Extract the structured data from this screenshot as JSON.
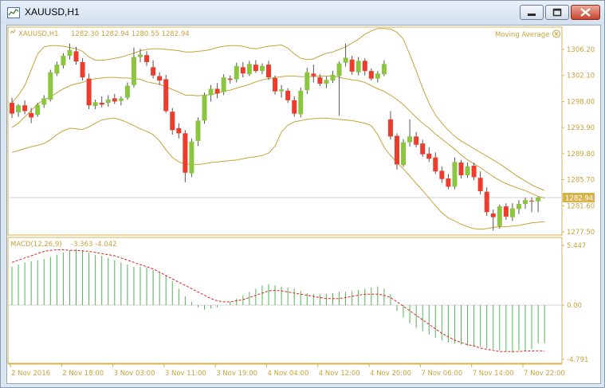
{
  "window": {
    "title": "XAUUSD,H1",
    "icon": "chart-window-icon",
    "controls": [
      "minimize-icon",
      "maximize-icon",
      "close-icon"
    ]
  },
  "main_chart": {
    "label": "XAUUSD,H1",
    "ohlc": "1282.30 1282.94 1280.55 1282.94",
    "indicator_label": "Moving Average",
    "indicator_icon": "moving-average-icon",
    "price_ticks": [
      "1306.20",
      "1302.10",
      "1298.00",
      "1293.90",
      "1289.80",
      "1285.70",
      "1281.60",
      "1277.50"
    ],
    "current_price": "1282.94"
  },
  "macd_panel": {
    "label": "MACD(12,26,9)",
    "values": "-3.363 -4.042",
    "ticks": [
      "5.447",
      "0.00",
      "-4.791"
    ]
  },
  "time_axis": [
    "2 Nov 2016",
    "2 Nov 18:00",
    "3 Nov 03:00",
    "3 Nov 11:00",
    "3 Nov 19:00",
    "4 Nov 04:00",
    "4 Nov 12:00",
    "4 Nov 20:00",
    "7 Nov 06:00",
    "7 Nov 14:00",
    "7 Nov 22:00"
  ],
  "colors": {
    "bull": "#8cc63f",
    "bear": "#ee3b2b",
    "bands": "#c8a33a",
    "frame": "#d8b24a",
    "macd_hist": "#52b553",
    "macd_signal": "#e02020",
    "text": "#c8a33a"
  },
  "chart_data": [
    {
      "type": "candlestick",
      "title": "XAUUSD,H1",
      "ylim": [
        1277.5,
        1306.2
      ],
      "candles": [
        {
          "o": 1297.8,
          "h": 1298.6,
          "l": 1295.4,
          "c": 1296.1
        },
        {
          "o": 1296.3,
          "h": 1297.6,
          "l": 1295.6,
          "c": 1297.4
        },
        {
          "o": 1297.4,
          "h": 1298.2,
          "l": 1296.0,
          "c": 1296.5
        },
        {
          "o": 1296.2,
          "h": 1297.0,
          "l": 1294.6,
          "c": 1295.5
        },
        {
          "o": 1295.9,
          "h": 1297.8,
          "l": 1295.6,
          "c": 1297.5
        },
        {
          "o": 1297.5,
          "h": 1299.0,
          "l": 1297.0,
          "c": 1298.5
        },
        {
          "o": 1298.3,
          "h": 1303.0,
          "l": 1298.0,
          "c": 1302.6
        },
        {
          "o": 1302.4,
          "h": 1304.3,
          "l": 1302.0,
          "c": 1303.8
        },
        {
          "o": 1303.7,
          "h": 1305.6,
          "l": 1303.2,
          "c": 1305.2
        },
        {
          "o": 1305.2,
          "h": 1307.1,
          "l": 1304.6,
          "c": 1306.1
        },
        {
          "o": 1305.9,
          "h": 1306.6,
          "l": 1303.8,
          "c": 1304.3
        },
        {
          "o": 1304.2,
          "h": 1304.8,
          "l": 1301.3,
          "c": 1301.8
        },
        {
          "o": 1301.6,
          "h": 1302.4,
          "l": 1296.8,
          "c": 1297.4
        },
        {
          "o": 1297.3,
          "h": 1298.3,
          "l": 1296.8,
          "c": 1297.9
        },
        {
          "o": 1297.8,
          "h": 1298.8,
          "l": 1297.1,
          "c": 1297.5
        },
        {
          "o": 1297.8,
          "h": 1299.0,
          "l": 1297.2,
          "c": 1298.3
        },
        {
          "o": 1298.5,
          "h": 1299.2,
          "l": 1297.6,
          "c": 1298.0
        },
        {
          "o": 1298.1,
          "h": 1298.8,
          "l": 1297.4,
          "c": 1298.5
        },
        {
          "o": 1298.6,
          "h": 1301.0,
          "l": 1298.3,
          "c": 1300.5
        },
        {
          "o": 1300.6,
          "h": 1306.5,
          "l": 1300.2,
          "c": 1305.0
        },
        {
          "o": 1305.0,
          "h": 1306.3,
          "l": 1304.2,
          "c": 1305.4
        },
        {
          "o": 1305.3,
          "h": 1305.9,
          "l": 1303.6,
          "c": 1304.2
        },
        {
          "o": 1303.4,
          "h": 1304.5,
          "l": 1301.6,
          "c": 1302.1
        },
        {
          "o": 1302.0,
          "h": 1302.6,
          "l": 1300.6,
          "c": 1301.3
        },
        {
          "o": 1301.5,
          "h": 1302.2,
          "l": 1296.2,
          "c": 1296.5
        },
        {
          "o": 1296.4,
          "h": 1297.0,
          "l": 1292.8,
          "c": 1293.5
        },
        {
          "o": 1293.8,
          "h": 1294.6,
          "l": 1292.2,
          "c": 1293.0
        },
        {
          "o": 1293.0,
          "h": 1293.5,
          "l": 1285.3,
          "c": 1286.8
        },
        {
          "o": 1286.7,
          "h": 1292.2,
          "l": 1286.1,
          "c": 1291.7
        },
        {
          "o": 1291.8,
          "h": 1295.5,
          "l": 1291.0,
          "c": 1295.0
        },
        {
          "o": 1295.0,
          "h": 1299.4,
          "l": 1294.5,
          "c": 1299.0
        },
        {
          "o": 1299.0,
          "h": 1300.6,
          "l": 1298.0,
          "c": 1300.0
        },
        {
          "o": 1300.0,
          "h": 1300.9,
          "l": 1298.5,
          "c": 1299.3
        },
        {
          "o": 1299.5,
          "h": 1302.3,
          "l": 1299.0,
          "c": 1301.8
        },
        {
          "o": 1301.6,
          "h": 1302.1,
          "l": 1300.8,
          "c": 1301.4
        },
        {
          "o": 1301.5,
          "h": 1304.1,
          "l": 1301.0,
          "c": 1303.6
        },
        {
          "o": 1303.4,
          "h": 1304.2,
          "l": 1301.8,
          "c": 1302.4
        },
        {
          "o": 1302.3,
          "h": 1304.4,
          "l": 1302.0,
          "c": 1303.9
        },
        {
          "o": 1303.8,
          "h": 1304.5,
          "l": 1302.5,
          "c": 1302.8
        },
        {
          "o": 1302.8,
          "h": 1304.0,
          "l": 1302.3,
          "c": 1303.6
        },
        {
          "o": 1303.8,
          "h": 1304.4,
          "l": 1301.4,
          "c": 1301.8
        },
        {
          "o": 1301.7,
          "h": 1302.1,
          "l": 1299.1,
          "c": 1299.6
        },
        {
          "o": 1299.6,
          "h": 1300.6,
          "l": 1298.6,
          "c": 1299.9
        },
        {
          "o": 1299.7,
          "h": 1300.1,
          "l": 1297.8,
          "c": 1298.2
        },
        {
          "o": 1298.2,
          "h": 1298.8,
          "l": 1295.6,
          "c": 1296.1
        },
        {
          "o": 1296.0,
          "h": 1300.2,
          "l": 1295.5,
          "c": 1299.7
        },
        {
          "o": 1299.8,
          "h": 1303.3,
          "l": 1299.2,
          "c": 1302.6
        },
        {
          "o": 1302.4,
          "h": 1303.8,
          "l": 1301.0,
          "c": 1302.0
        },
        {
          "o": 1301.8,
          "h": 1302.3,
          "l": 1300.4,
          "c": 1300.8
        },
        {
          "o": 1300.8,
          "h": 1301.9,
          "l": 1300.1,
          "c": 1301.4
        },
        {
          "o": 1301.3,
          "h": 1302.8,
          "l": 1300.9,
          "c": 1302.2
        },
        {
          "o": 1302.0,
          "h": 1304.3,
          "l": 1295.8,
          "c": 1304.0
        },
        {
          "o": 1304.1,
          "h": 1307.1,
          "l": 1303.5,
          "c": 1304.9
        },
        {
          "o": 1304.6,
          "h": 1305.2,
          "l": 1302.2,
          "c": 1302.7
        },
        {
          "o": 1302.6,
          "h": 1305.0,
          "l": 1302.1,
          "c": 1304.4
        },
        {
          "o": 1304.4,
          "h": 1304.8,
          "l": 1302.1,
          "c": 1302.8
        },
        {
          "o": 1302.8,
          "h": 1303.2,
          "l": 1301.3,
          "c": 1301.6
        },
        {
          "o": 1301.6,
          "h": 1302.8,
          "l": 1301.0,
          "c": 1302.4
        },
        {
          "o": 1302.3,
          "h": 1304.5,
          "l": 1302.0,
          "c": 1303.9
        },
        {
          "o": 1295.2,
          "h": 1296.5,
          "l": 1292.0,
          "c": 1292.5
        },
        {
          "o": 1292.6,
          "h": 1293.0,
          "l": 1287.3,
          "c": 1288.1
        },
        {
          "o": 1288.0,
          "h": 1292.1,
          "l": 1287.7,
          "c": 1291.6
        },
        {
          "o": 1291.6,
          "h": 1295.2,
          "l": 1290.9,
          "c": 1292.5
        },
        {
          "o": 1292.5,
          "h": 1293.2,
          "l": 1290.8,
          "c": 1291.2
        },
        {
          "o": 1291.4,
          "h": 1292.0,
          "l": 1289.3,
          "c": 1289.7
        },
        {
          "o": 1289.8,
          "h": 1290.8,
          "l": 1288.5,
          "c": 1289.0
        },
        {
          "o": 1289.2,
          "h": 1290.0,
          "l": 1286.6,
          "c": 1287.0
        },
        {
          "o": 1287.1,
          "h": 1287.8,
          "l": 1285.2,
          "c": 1285.8
        },
        {
          "o": 1285.9,
          "h": 1286.6,
          "l": 1284.2,
          "c": 1284.6
        },
        {
          "o": 1284.6,
          "h": 1289.2,
          "l": 1284.2,
          "c": 1288.5
        },
        {
          "o": 1288.4,
          "h": 1288.8,
          "l": 1285.9,
          "c": 1286.4
        },
        {
          "o": 1286.4,
          "h": 1288.4,
          "l": 1286.0,
          "c": 1287.8
        },
        {
          "o": 1287.9,
          "h": 1288.4,
          "l": 1285.6,
          "c": 1286.1
        },
        {
          "o": 1286.0,
          "h": 1287.0,
          "l": 1283.4,
          "c": 1283.9
        },
        {
          "o": 1283.8,
          "h": 1284.5,
          "l": 1280.0,
          "c": 1280.6
        },
        {
          "o": 1280.4,
          "h": 1281.0,
          "l": 1277.7,
          "c": 1279.8
        },
        {
          "o": 1278.4,
          "h": 1281.8,
          "l": 1278.0,
          "c": 1281.5
        },
        {
          "o": 1281.5,
          "h": 1282.0,
          "l": 1279.4,
          "c": 1279.9
        },
        {
          "o": 1279.8,
          "h": 1282.0,
          "l": 1279.2,
          "c": 1281.2
        },
        {
          "o": 1281.1,
          "h": 1282.5,
          "l": 1280.3,
          "c": 1281.9
        },
        {
          "o": 1281.9,
          "h": 1282.9,
          "l": 1281.1,
          "c": 1282.5
        },
        {
          "o": 1282.4,
          "h": 1282.9,
          "l": 1280.6,
          "c": 1282.3
        },
        {
          "o": 1282.3,
          "h": 1283.0,
          "l": 1280.6,
          "c": 1282.9
        }
      ],
      "bollinger_upper": [
        1297.8,
        1299.0,
        1300.5,
        1303.0,
        1305.5,
        1306.6,
        1306.8,
        1306.8,
        1306.7,
        1306.5,
        1306.3,
        1305.9,
        1305.0,
        1304.5,
        1304.5,
        1304.6,
        1304.8,
        1305.0,
        1305.3,
        1305.6,
        1306.0,
        1306.2,
        1306.3,
        1306.3,
        1306.2,
        1306.1,
        1306.0,
        1305.8,
        1305.8,
        1305.9,
        1306.0,
        1306.2,
        1306.5,
        1306.7,
        1306.8,
        1306.8,
        1306.7,
        1306.4,
        1306.3,
        1306.5,
        1306.7,
        1306.8,
        1306.9,
        1306.4,
        1305.5,
        1304.8,
        1304.6,
        1304.7,
        1305.2,
        1305.6,
        1305.8,
        1306.2,
        1306.6,
        1307.2,
        1307.8,
        1308.6,
        1309.1,
        1309.5,
        1309.5,
        1309.4,
        1308.9,
        1307.8,
        1305.4,
        1302.8,
        1300.1,
        1297.7,
        1295.9,
        1294.6,
        1293.5,
        1292.5,
        1291.8,
        1291.2,
        1290.6,
        1290.0,
        1289.4,
        1288.8,
        1288.2,
        1287.5,
        1286.8,
        1286.1,
        1285.5,
        1284.9,
        1284.4,
        1284.0
      ],
      "bollinger_middle": [
        1293.9,
        1294.6,
        1295.6,
        1296.6,
        1297.6,
        1298.3,
        1298.7,
        1299.4,
        1300.0,
        1300.5,
        1300.8,
        1301.0,
        1301.4,
        1301.6,
        1301.7,
        1301.8,
        1301.8,
        1301.7,
        1301.7,
        1301.6,
        1301.5,
        1301.1,
        1300.9,
        1300.7,
        1300.3,
        1299.9,
        1299.5,
        1299.0,
        1299.0,
        1298.9,
        1299.0,
        1299.1,
        1299.3,
        1299.6,
        1299.8,
        1300.1,
        1300.4,
        1300.7,
        1301.1,
        1301.4,
        1301.6,
        1301.8,
        1301.9,
        1302.0,
        1302.0,
        1301.9,
        1301.9,
        1301.9,
        1302.0,
        1302.0,
        1302.0,
        1301.8,
        1301.6,
        1301.4,
        1301.3,
        1301.0,
        1300.5,
        1300.0,
        1299.6,
        1299.0,
        1298.3,
        1297.5,
        1296.5,
        1295.5,
        1294.6,
        1293.8,
        1292.9,
        1292.1,
        1291.3,
        1290.5,
        1289.6,
        1288.8,
        1288.2,
        1287.6,
        1286.9,
        1286.2,
        1285.6,
        1285.1,
        1284.7,
        1284.3,
        1284.0,
        1283.5,
        1283.1,
        1282.8
      ],
      "bollinger_lower": [
        1290.0,
        1290.3,
        1290.6,
        1290.9,
        1291.1,
        1291.4,
        1292.0,
        1292.8,
        1293.4,
        1293.8,
        1293.7,
        1293.6,
        1294.0,
        1294.6,
        1295.1,
        1295.3,
        1295.4,
        1295.1,
        1294.7,
        1294.2,
        1293.7,
        1293.3,
        1292.8,
        1291.8,
        1290.4,
        1289.2,
        1288.5,
        1288.2,
        1288.1,
        1288.1,
        1288.2,
        1288.4,
        1288.5,
        1288.6,
        1288.7,
        1288.8,
        1289.0,
        1289.2,
        1289.3,
        1289.5,
        1289.9,
        1291.0,
        1293.2,
        1294.3,
        1294.8,
        1295.0,
        1295.2,
        1295.3,
        1295.4,
        1295.4,
        1295.3,
        1295.2,
        1295.1,
        1295.0,
        1294.8,
        1294.6,
        1294.2,
        1292.8,
        1290.8,
        1289.5,
        1288.4,
        1287.4,
        1286.3,
        1285.1,
        1284.0,
        1282.8,
        1281.6,
        1280.5,
        1279.7,
        1279.2,
        1278.7,
        1278.3,
        1278.0,
        1277.9,
        1278.0,
        1278.2,
        1278.3,
        1278.3,
        1278.4,
        1278.5,
        1278.7,
        1278.9,
        1279.0,
        1279.1
      ],
      "xlabels": [
        "2 Nov 2016",
        "2 Nov 18:00",
        "3 Nov 03:00",
        "3 Nov 11:00",
        "3 Nov 19:00",
        "4 Nov 04:00",
        "4 Nov 12:00",
        "4 Nov 20:00",
        "7 Nov 06:00",
        "7 Nov 14:00",
        "7 Nov 22:00"
      ],
      "last_price": 1282.94
    },
    {
      "type": "bar",
      "title": "MACD(12,26,9)",
      "ylim": [
        -4.791,
        5.447
      ],
      "histogram": [
        3.5,
        3.7,
        3.9,
        4.0,
        4.1,
        4.2,
        4.4,
        4.6,
        4.8,
        5.0,
        5.1,
        5.0,
        4.8,
        4.6,
        4.5,
        4.3,
        4.1,
        3.9,
        3.7,
        3.5,
        3.5,
        3.4,
        3.2,
        3.0,
        2.7,
        2.2,
        1.5,
        0.8,
        0.3,
        -0.2,
        -0.4,
        -0.3,
        -0.2,
        0.0,
        0.3,
        0.6,
        0.9,
        1.2,
        1.5,
        1.8,
        1.9,
        1.8,
        1.7,
        1.6,
        1.5,
        1.3,
        1.1,
        1.0,
        1.0,
        1.0,
        1.1,
        1.2,
        1.2,
        1.3,
        1.4,
        1.5,
        1.6,
        1.7,
        1.5,
        1.0,
        -0.5,
        -1.1,
        -1.6,
        -2.0,
        -2.3,
        -2.6,
        -2.9,
        -3.1,
        -3.3,
        -3.4,
        -3.5,
        -3.6,
        -3.6,
        -3.7,
        -3.8,
        -3.9,
        -4.0,
        -4.1,
        -4.2,
        -4.0,
        -4.0,
        -3.9,
        -3.4,
        -3.363
      ],
      "signal": [
        3.9,
        4.1,
        4.3,
        4.5,
        4.7,
        4.9,
        5.0,
        5.05,
        5.05,
        5.0,
        5.0,
        4.95,
        4.9,
        4.8,
        4.7,
        4.6,
        4.5,
        4.3,
        4.1,
        3.9,
        3.7,
        3.5,
        3.3,
        3.0,
        2.7,
        2.4,
        2.1,
        1.8,
        1.5,
        1.2,
        0.9,
        0.6,
        0.4,
        0.3,
        0.3,
        0.4,
        0.5,
        0.7,
        0.9,
        1.1,
        1.3,
        1.35,
        1.3,
        1.2,
        1.1,
        1.0,
        0.9,
        0.8,
        0.7,
        0.6,
        0.6,
        0.6,
        0.7,
        0.8,
        0.9,
        1.0,
        1.0,
        1.0,
        0.9,
        0.7,
        0.3,
        -0.1,
        -0.5,
        -0.9,
        -1.3,
        -1.7,
        -2.1,
        -2.5,
        -2.8,
        -3.1,
        -3.3,
        -3.5,
        -3.6,
        -3.8,
        -3.9,
        -4.0,
        -4.1,
        -4.1,
        -4.1,
        -4.1,
        -4.05,
        -4.05,
        -4.04,
        -4.042
      ],
      "values_label": "-3.363 -4.042"
    }
  ]
}
